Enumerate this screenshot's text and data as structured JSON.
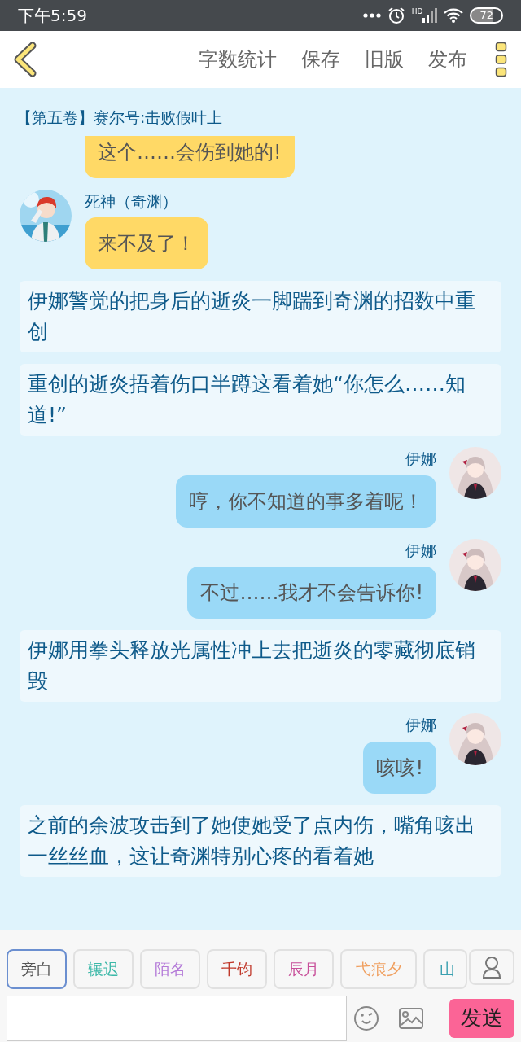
{
  "status_bar": {
    "time": "下午5:59",
    "signal_label": "HD",
    "battery": "72"
  },
  "toolbar": {
    "actions": [
      "字数统计",
      "保存",
      "旧版",
      "发布"
    ]
  },
  "chapter_title": "【第五卷】赛尔号:击败假叶上",
  "messages": [
    {
      "kind": "left",
      "text": "这个……会伤到她的!"
    },
    {
      "kind": "left",
      "name": "死神（奇渊）",
      "text": "来不及了！"
    },
    {
      "kind": "narration",
      "text": "伊娜警觉的把身后的逝炎一脚踹到奇渊的招数中重创"
    },
    {
      "kind": "narration",
      "text": "重创的逝炎捂着伤口半蹲这看着她“你怎么……知道!”"
    },
    {
      "kind": "right",
      "name": "伊娜",
      "text": "哼，你不知道的事多着呢！"
    },
    {
      "kind": "right",
      "name": "伊娜",
      "text": "不过……我才不会告诉你!"
    },
    {
      "kind": "narration",
      "text": "伊娜用拳头释放光属性冲上去把逝炎的零藏彻底销毁"
    },
    {
      "kind": "right",
      "name": "伊娜",
      "text": "咳咳!"
    },
    {
      "kind": "narration",
      "text": "之前的余波攻击到了她使她受了点内伤，嘴角咳出一丝丝血，这让奇渊特别心疼的看着她"
    }
  ],
  "roles": [
    {
      "label": "旁白",
      "color": "#555555",
      "selected": true
    },
    {
      "label": "辗迟",
      "color": "#3cb8a8",
      "selected": false
    },
    {
      "label": "陌名",
      "color": "#b47ad8",
      "selected": false
    },
    {
      "label": "千钧",
      "color": "#c0392b",
      "selected": false
    },
    {
      "label": "辰月",
      "color": "#c8509a",
      "selected": false
    },
    {
      "label": "弋痕夕",
      "color": "#f0a060",
      "selected": false
    },
    {
      "label": "山",
      "color": "#3aa0b0",
      "selected": false
    }
  ],
  "send_button": "发送"
}
